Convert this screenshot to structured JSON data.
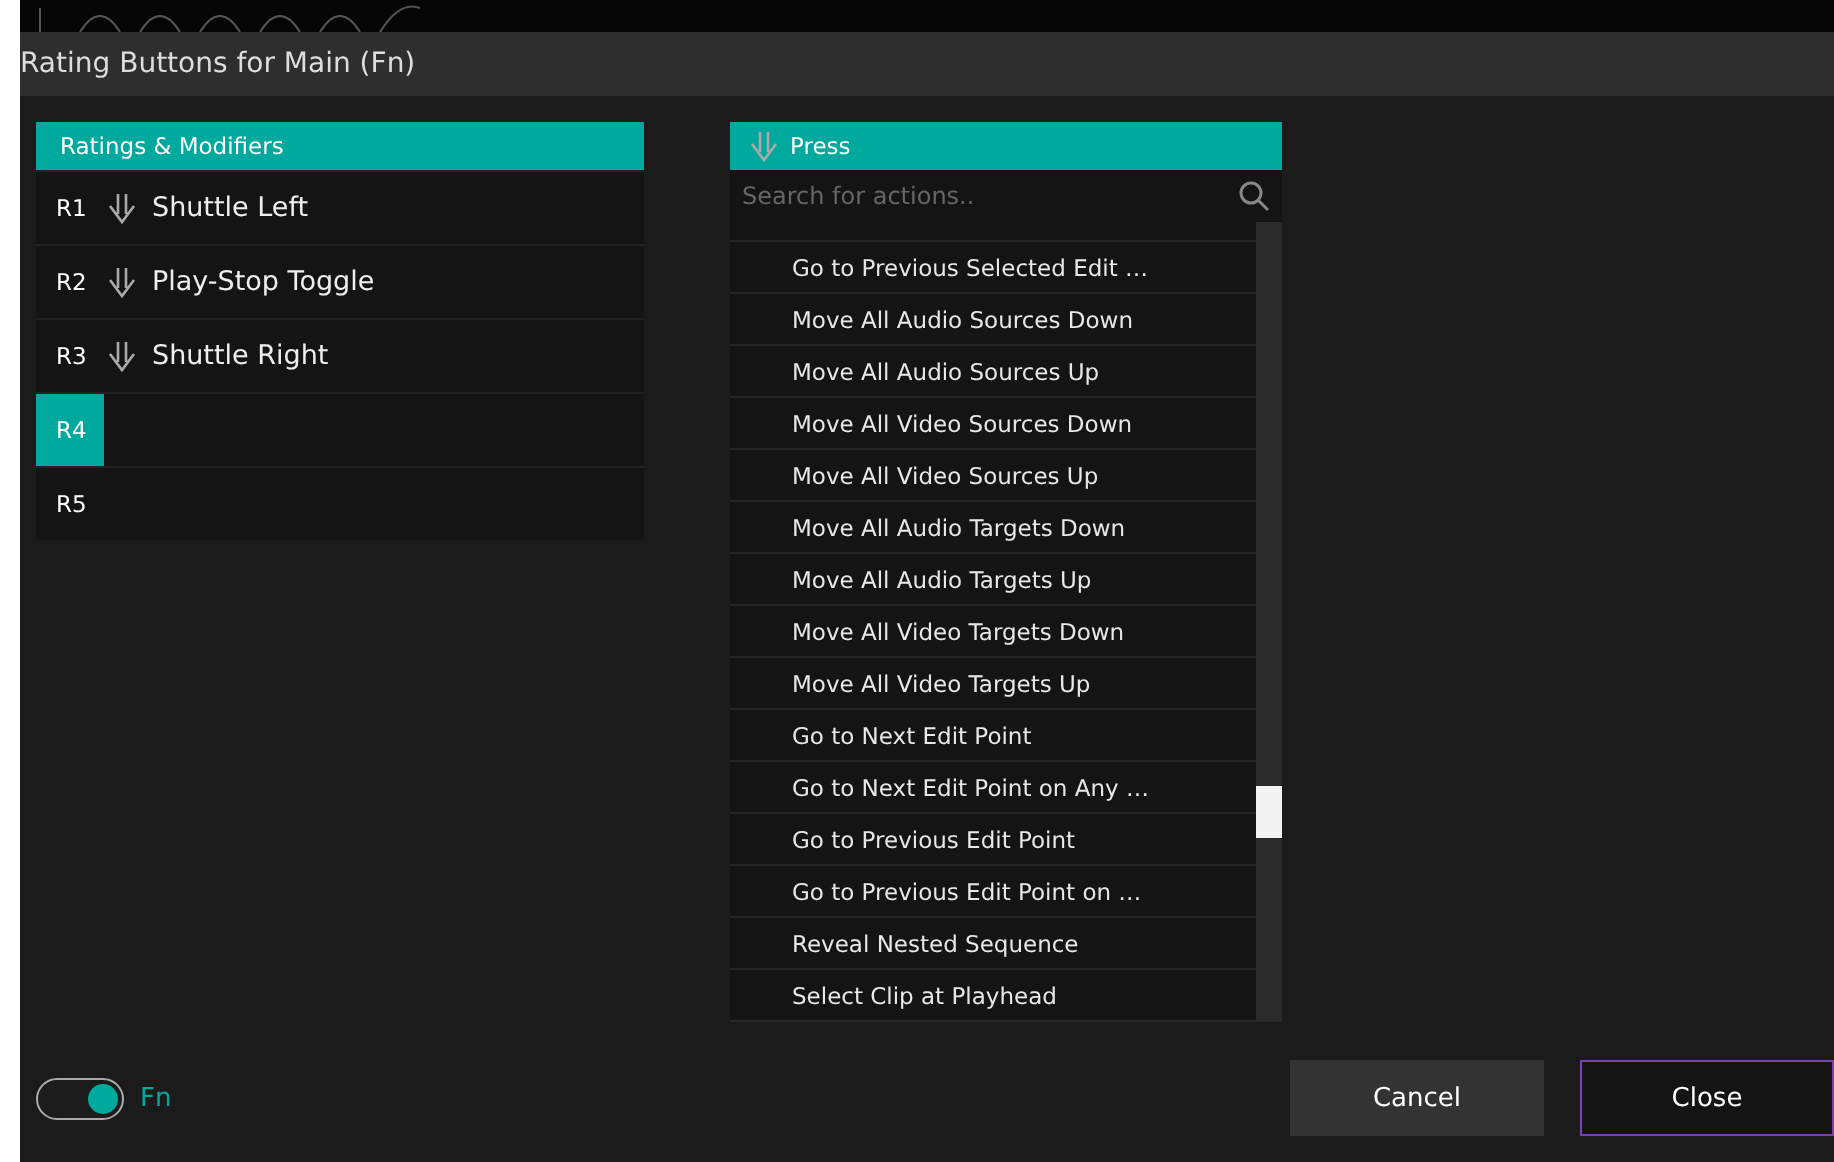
{
  "window": {
    "title": "Rating Buttons for Main (Fn)"
  },
  "ratings": {
    "header": "Ratings & Modifiers",
    "rows": [
      {
        "key": "R1",
        "action": "Shuttle Left",
        "selected": false
      },
      {
        "key": "R2",
        "action": "Play-Stop Toggle",
        "selected": false
      },
      {
        "key": "R3",
        "action": "Shuttle Right",
        "selected": false
      },
      {
        "key": "R4",
        "selected": true
      },
      {
        "key": "R5",
        "selected": false
      }
    ]
  },
  "actions": {
    "header": "Press",
    "search": {
      "placeholder": "Search for actions.."
    },
    "items": [
      "Go to Previous Selected Edit …",
      "Move All Audio Sources Down",
      "Move All Audio Sources Up",
      "Move All Video Sources Down",
      "Move All Video Sources Up",
      "Move All Audio Targets Down",
      "Move All Audio Targets Up",
      "Move All Video Targets Down",
      "Move All Video Targets Up",
      "Go to Next Edit Point",
      "Go to Next Edit Point on Any …",
      "Go to Previous Edit Point",
      "Go to Previous Edit Point on …",
      "Reveal Nested Sequence",
      "Select Clip at Playhead"
    ]
  },
  "footer": {
    "toggle": {
      "label": "Fn",
      "on": true
    },
    "buttons": [
      {
        "label": "Cancel",
        "kind": "secondary"
      },
      {
        "label": "Close",
        "kind": "primary"
      }
    ]
  }
}
